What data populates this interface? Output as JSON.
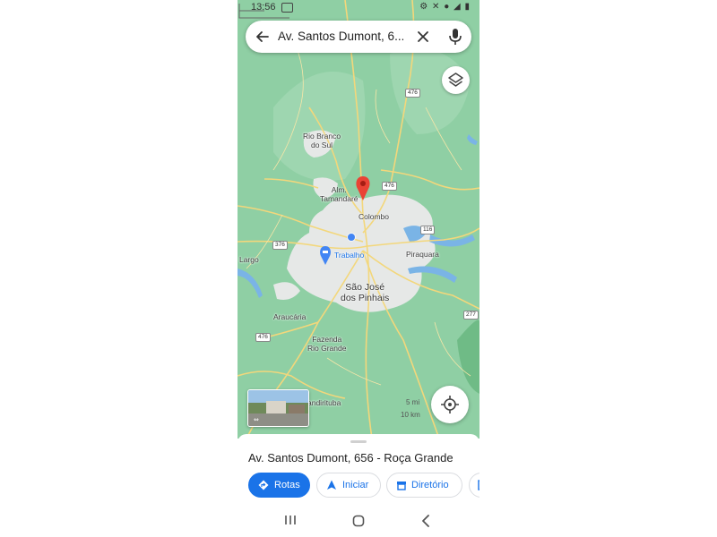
{
  "status_bar": {
    "time": "13:56",
    "icons": "⚙ ✕ ● ◢ ▮"
  },
  "search": {
    "query": "Av. Santos Dumont, 6..."
  },
  "map": {
    "labels": {
      "rio_branco_do_sul": "Rio Branco\ndo Sul",
      "almirante_tamandare": "Alm.\nTamandaré",
      "colombo": "Colombo",
      "trabalho": "Trabalho",
      "largo": "Largo",
      "piraquara": "Piraquara",
      "sao_jose_dos_pinhais": "São José\ndos Pinhais",
      "araucaria": "Araucária",
      "fazenda_rio_grande": "Fazenda\nRio Grande",
      "mandirituba": "andirituba"
    },
    "shields": {
      "r476_top": "476",
      "r476_mid": "476",
      "r376": "376",
      "r116": "116",
      "r277": "277",
      "r476_bottom": "476"
    },
    "scale": {
      "small": "5 mi",
      "large": "10 km"
    },
    "colors": {
      "land": "#8fcfa4",
      "urban": "#e8eae9",
      "road": "#f6d56a",
      "pin": "#ea4335",
      "blue_dot": "#4285f4"
    }
  },
  "sheet": {
    "title": "Av. Santos Dumont, 656 - Roça Grande",
    "chips": {
      "rotas": "Rotas",
      "iniciar": "Iniciar",
      "diretorio": "Diretório"
    }
  },
  "accent": "#1a73e8"
}
